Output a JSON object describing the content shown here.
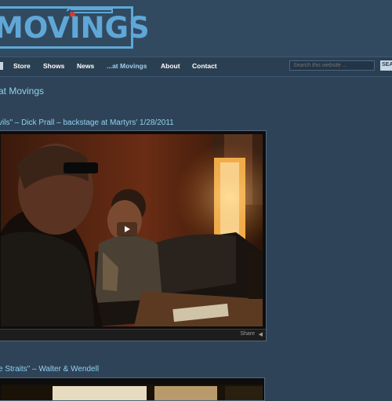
{
  "header": {
    "logo_text": "MOVINGS"
  },
  "nav": {
    "items": [
      {
        "label": "Store"
      },
      {
        "label": "Shows"
      },
      {
        "label": "News"
      },
      {
        "label": "...at Movings"
      },
      {
        "label": "About"
      },
      {
        "label": "Contact"
      }
    ],
    "search_placeholder": "Search this website ...",
    "search_button": "SEA"
  },
  "page": {
    "title": "at Movings"
  },
  "posts": [
    {
      "title": "vils\" – Dick Prall – backstage at Martyrs' 1/28/2011",
      "share_label": "Share"
    },
    {
      "title": "e Straits\" – Walter & Wendell"
    }
  ]
}
